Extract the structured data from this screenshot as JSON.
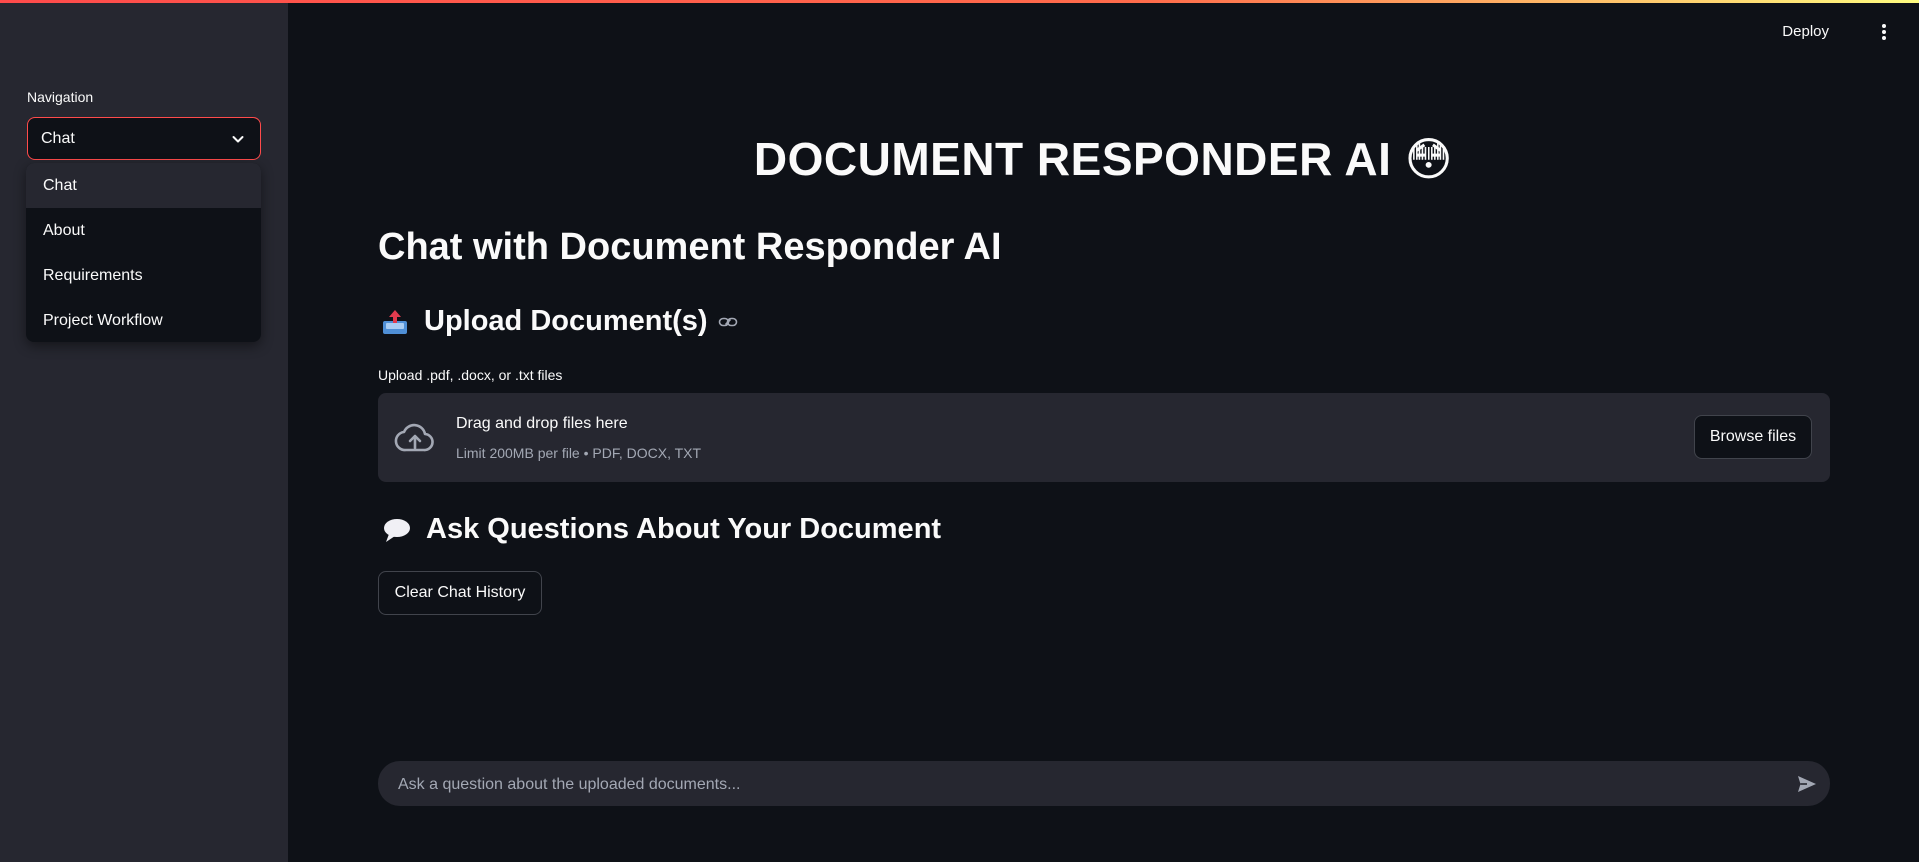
{
  "header": {
    "deploy_label": "Deploy",
    "menu_icon": "kebab-icon"
  },
  "sidebar": {
    "nav_label": "Navigation",
    "selected": "Chat",
    "options": [
      "Chat",
      "About",
      "Requirements",
      "Project Workflow"
    ]
  },
  "main": {
    "app_title": "DOCUMENT RESPONDER AI 😳",
    "chat_heading": "Chat with Document Responder AI",
    "upload_heading": "Upload Document(s)",
    "upload_label": "Upload .pdf, .docx, or .txt files",
    "dropzone_main": "Drag and drop files here",
    "dropzone_sub": "Limit 200MB per file • PDF, DOCX, TXT",
    "browse_label": "Browse files",
    "ask_heading": "Ask Questions About Your Document",
    "clear_label": "Clear Chat History"
  },
  "chat_input": {
    "placeholder": "Ask a question about the uploaded documents..."
  },
  "colors": {
    "background": "#0e1117",
    "sidebar": "#262730",
    "accent": "#ff4b4b"
  }
}
